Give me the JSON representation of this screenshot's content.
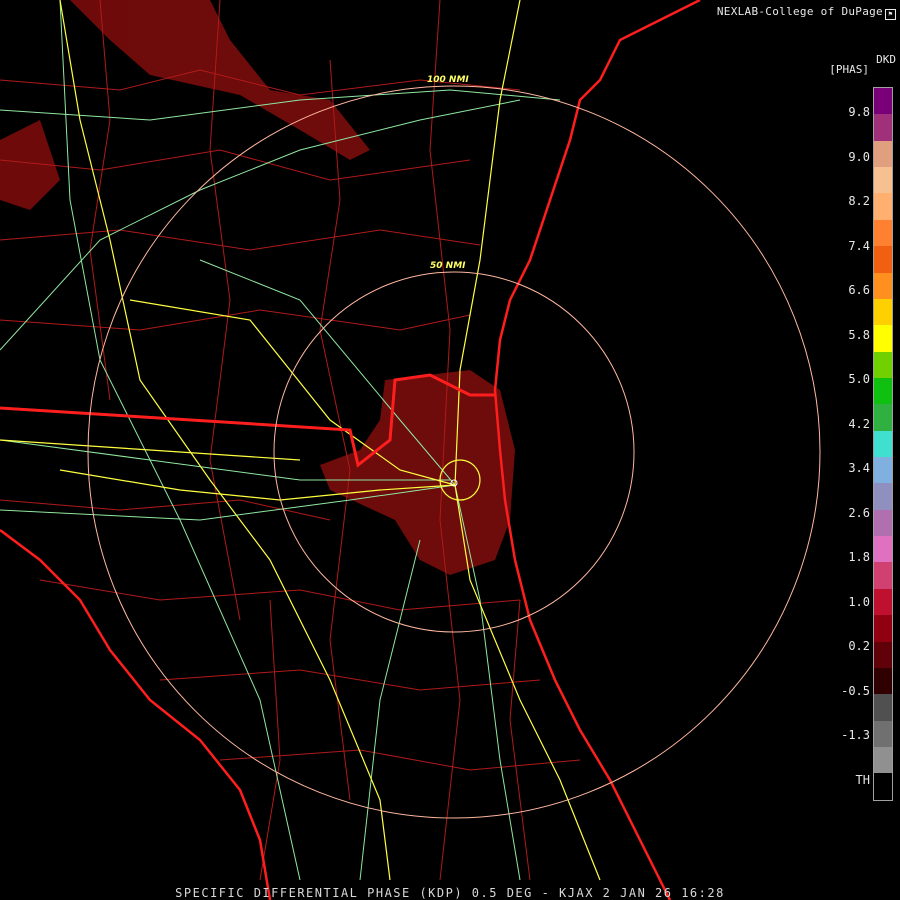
{
  "credit": "NEXLAB-College of DuPage",
  "product_code": "DKD",
  "units": "[PHAS]",
  "footer": "SPECIFIC DIFFERENTIAL PHASE (KDP) 0.5 DEG - KJAX 2 JAN 26 16:28",
  "rings": [
    {
      "label": "100 NMI"
    },
    {
      "label": "50 NMI"
    }
  ],
  "legend_ticks": [
    "9.8",
    "9.0",
    "8.2",
    "7.4",
    "6.6",
    "5.8",
    "5.0",
    "4.2",
    "3.4",
    "2.6",
    "1.8",
    "1.0",
    "0.2",
    "-0.5",
    "-1.3",
    "TH"
  ],
  "colors": {
    "background": "#000000",
    "coast": "#ff1e1e",
    "county": "#b01a1a",
    "highway": "#ffff40",
    "road": "#90e8a0",
    "ring": "#ffb8a0",
    "echo": "#7a0c0c",
    "colorbar": [
      "#7a007a",
      "#a0307a",
      "#e0a080",
      "#f6c090",
      "#ffb070",
      "#ff8030",
      "#f06010",
      "#ff9020",
      "#ffd000",
      "#ffff00",
      "#70d000",
      "#10c010",
      "#30b040",
      "#40e0d0",
      "#80b0e0",
      "#9090c0",
      "#b070b0",
      "#e070c0",
      "#d04070",
      "#c01030",
      "#900010",
      "#600008",
      "#300000",
      "#505050",
      "#707070",
      "#909090",
      "#000000"
    ]
  }
}
